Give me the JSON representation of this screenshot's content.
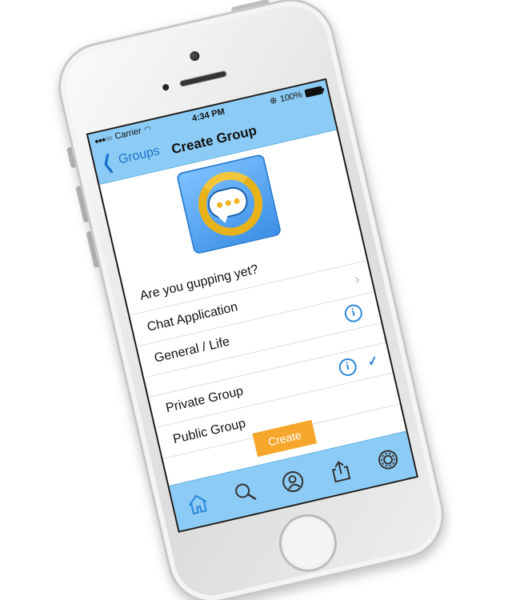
{
  "status_bar": {
    "carrier": "Carrier",
    "time": "4:34 PM",
    "battery": "100%"
  },
  "nav": {
    "back_label": "Groups",
    "title": "Create Group"
  },
  "form": {
    "description": "Are you gupping yet?",
    "category": "Chat Application",
    "subcategory": "General / Life",
    "private_label": "Private Group",
    "public_label": "Public Group",
    "selected_privacy": "Private Group"
  },
  "actions": {
    "create_label": "Create"
  },
  "tab_bar": {
    "items": [
      "home-icon",
      "search-icon",
      "profile-icon",
      "share-icon",
      "settings-icon"
    ]
  },
  "colors": {
    "bar_blue": "#8ccbf5",
    "accent_blue": "#2b86d9",
    "create_orange": "#f6a72b"
  }
}
